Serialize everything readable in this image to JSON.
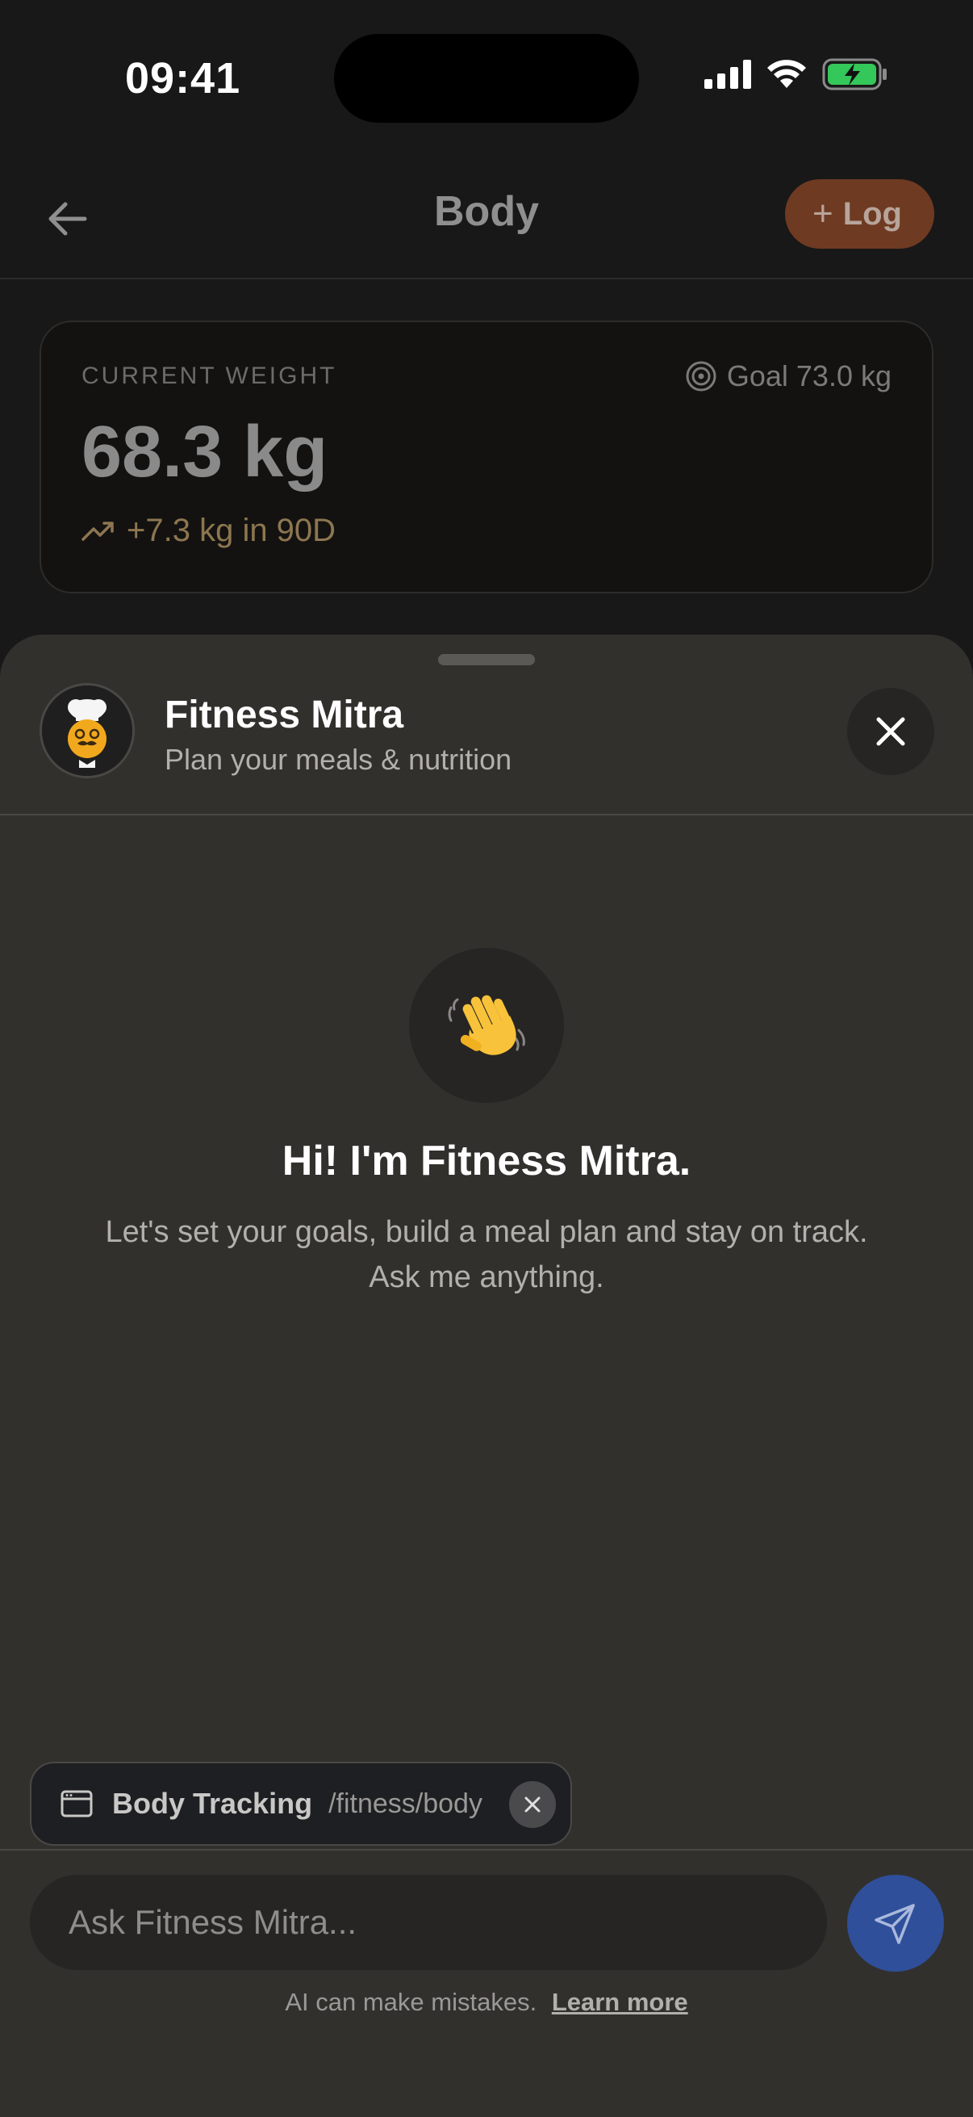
{
  "status_bar": {
    "time": "09:41"
  },
  "nav": {
    "back_icon": "arrow-left-icon",
    "title": "Body",
    "log_button": {
      "icon": "plus-icon",
      "label": "Log"
    }
  },
  "weight_card": {
    "label": "CURRENT WEIGHT",
    "goal_icon": "target-icon",
    "goal": "Goal 73.0 kg",
    "value": "68.3 kg",
    "trend_icon": "trending-up-icon",
    "trend": "+7.3 kg in 90D"
  },
  "sheet": {
    "assistant_name": "Fitness Mitra",
    "assistant_subtitle": "Plan your meals & nutrition",
    "welcome_icon": "waving-hand-icon",
    "welcome_title": "Hi! I'm Fitness Mitra.",
    "welcome_text": "Let's set your goals, build a meal plan and stay on track. Ask me anything.",
    "context_chip": {
      "icon": "browser-window-icon",
      "label": "Body Tracking",
      "path": "/fitness/body"
    },
    "input_placeholder": "Ask Fitness Mitra...",
    "disclaimer": "AI can make mistakes.",
    "learn_more": "Learn more"
  },
  "colors": {
    "accent_log": "#6f3a22",
    "send_button": "#2f4f9a",
    "trend": "#8d7650",
    "battery": "#34c759"
  }
}
